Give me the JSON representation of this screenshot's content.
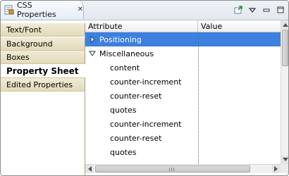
{
  "view": {
    "title": "CSS Properties",
    "tab_icon": "css-properties-icon",
    "close_icon": "close-icon",
    "toolbar": {
      "icons": [
        "pin-view-icon",
        "view-menu-icon",
        "minimize-icon",
        "maximize-icon"
      ]
    }
  },
  "categories": [
    {
      "label": "Text/Font",
      "active": false
    },
    {
      "label": "Background",
      "active": false
    },
    {
      "label": "Boxes",
      "active": false
    },
    {
      "label": "Property Sheet",
      "active": true
    },
    {
      "label": "Edited Properties",
      "active": false
    }
  ],
  "table": {
    "columns": [
      "Attribute",
      "Value"
    ],
    "rows": [
      {
        "attribute": "Positioning",
        "value": "",
        "level": 0,
        "expandable": true,
        "expanded": false,
        "selected": true
      },
      {
        "attribute": "Miscellaneous",
        "value": "",
        "level": 0,
        "expandable": true,
        "expanded": true,
        "selected": false
      },
      {
        "attribute": "content",
        "value": "",
        "level": 1
      },
      {
        "attribute": "counter-increment",
        "value": "",
        "level": 1
      },
      {
        "attribute": "counter-reset",
        "value": "",
        "level": 1
      },
      {
        "attribute": "quotes",
        "value": "",
        "level": 1
      },
      {
        "attribute": "counter-increment",
        "value": "",
        "level": 1
      },
      {
        "attribute": "counter-reset",
        "value": "",
        "level": 1
      },
      {
        "attribute": "quotes",
        "value": "",
        "level": 1
      }
    ]
  },
  "colors": {
    "selection": "#3d80df",
    "tab_bg": "#e7eef8",
    "category_bg": "#e2dab8"
  }
}
